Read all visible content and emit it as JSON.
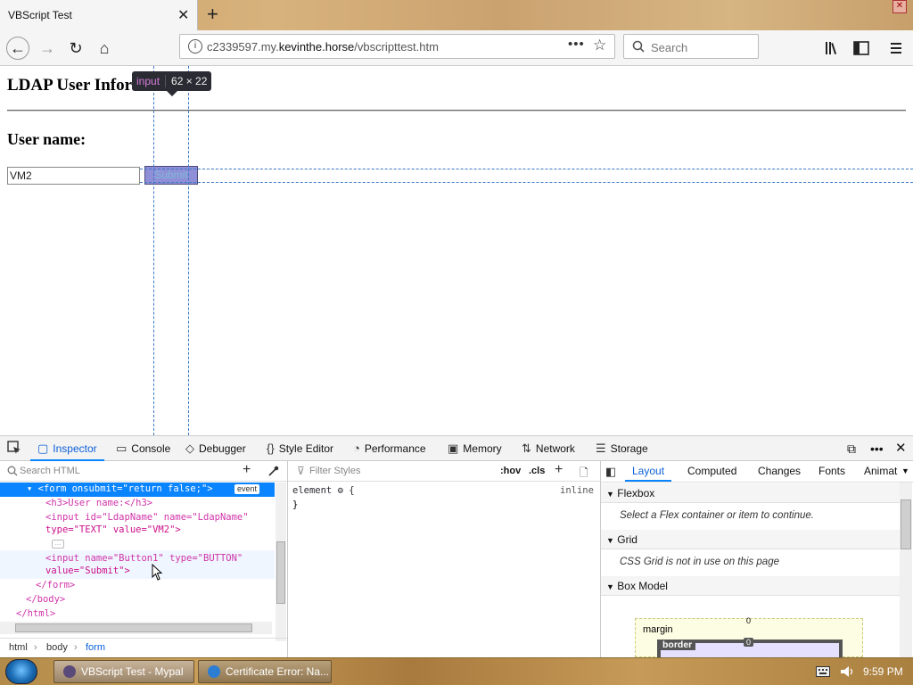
{
  "browser": {
    "tab_title": "VBScript Test",
    "close_glyph": "✕",
    "new_tab_glyph": "+",
    "url_host_prefix": "c2339597.my.",
    "url_host_domain": "kevinthe.horse",
    "url_path": "/vbscripttest.htm",
    "url_more_glyph": "•••",
    "search_placeholder": "Search"
  },
  "page": {
    "heading": "LDAP User Information",
    "user_label": "User name:",
    "ldap_input_value": "VM2",
    "submit_label": "Submit"
  },
  "highlighter": {
    "tag": "input",
    "dimensions": "62 × 22"
  },
  "devtools": {
    "tabs": [
      {
        "label": "Inspector"
      },
      {
        "label": "Console"
      },
      {
        "label": "Debugger"
      },
      {
        "label": "Style Editor"
      },
      {
        "label": "Performance"
      },
      {
        "label": "Memory"
      },
      {
        "label": "Network"
      },
      {
        "label": "Storage"
      }
    ],
    "search_html_placeholder": "Search HTML",
    "filter_styles_placeholder": "Filter Styles",
    "hov_label": ":hov",
    "cls_label": ".cls",
    "event_badge": "event",
    "code_lines": {
      "form_open": "<form onsubmit=\"return false;\">",
      "h3": "<h3>User name:</h3>",
      "input1_a": "<input id=\"LdapName\" name=\"LdapName\"",
      "input1_b": "type=\"TEXT\" value=\"VM2\">",
      "input2_a": "<input name=\"Button1\" type=\"BUTTON\"",
      "input2_b": "value=\"Submit\">",
      "form_close": "</form>",
      "body_close": "</body>",
      "html_close": "</html>"
    },
    "breadcrumbs": [
      "html",
      "body",
      "form"
    ],
    "rule_selector": "element",
    "rule_open": "{",
    "rule_close": "}",
    "rule_source": "inline",
    "layout_tabs": [
      "Layout",
      "Computed",
      "Changes",
      "Fonts",
      "Animat"
    ],
    "sections": [
      {
        "title": "Flexbox",
        "message": "Select a Flex container or item to continue."
      },
      {
        "title": "Grid",
        "message": "CSS Grid is not in use on this page"
      },
      {
        "title": "Box Model",
        "message": ""
      }
    ],
    "box_model": {
      "margin_label": "margin",
      "border_label": "border",
      "margin_top": "0",
      "border_top": "0"
    }
  },
  "taskbar": {
    "task1": "VBScript Test - Mypal",
    "task2": "Certificate Error: Na...",
    "clock": "9:59 PM"
  }
}
